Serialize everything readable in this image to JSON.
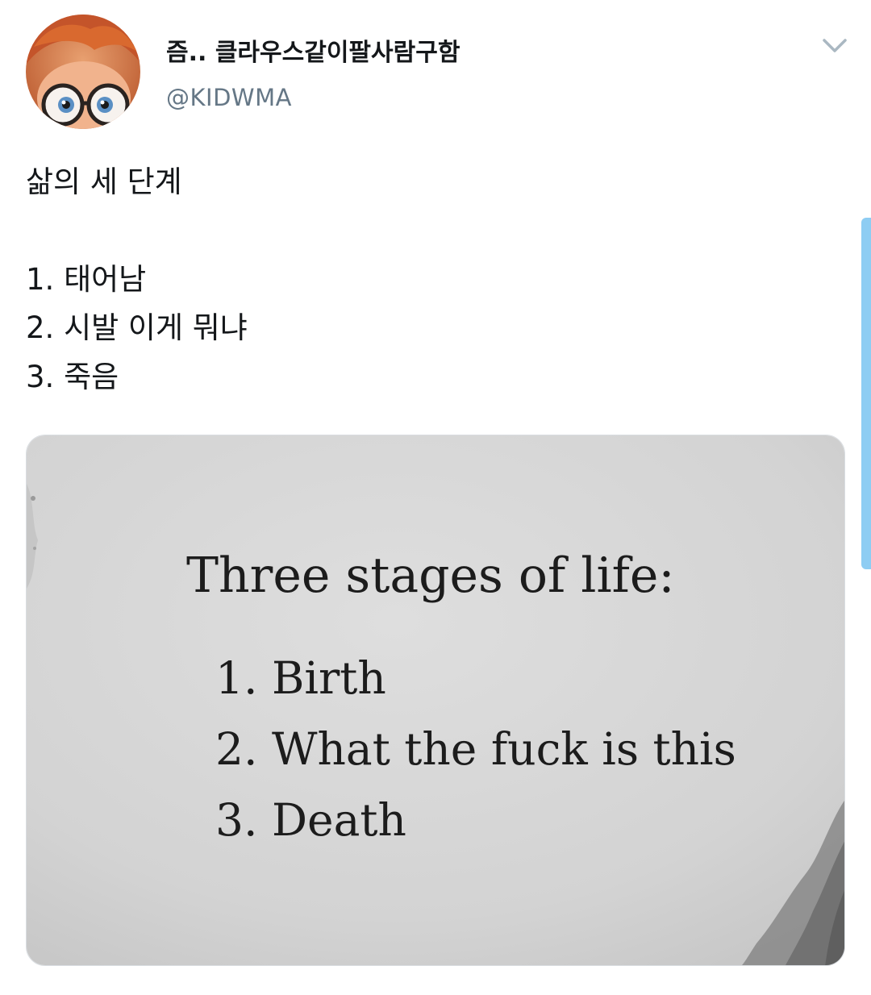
{
  "user": {
    "display_name": "즘.. 클라우스같이팔사람구함",
    "handle": "@KIDWMA"
  },
  "tweet": {
    "title": "삶의 세 단계",
    "lines": [
      "1. 태어남",
      "2. 시발 이게 뭐냐",
      "3. 죽음"
    ]
  },
  "media": {
    "heading": "Three stages of life:",
    "lines": [
      "1. Birth",
      "2. What the fuck is this",
      "3. Death"
    ]
  },
  "icons": {
    "menu": "chevron-down-icon",
    "avatar": "cartoon-avatar-with-glasses"
  },
  "colors": {
    "handle": "#657786",
    "chevron": "#aab8c2",
    "scrollbar": "#8ecdf3",
    "text": "#14171a"
  }
}
